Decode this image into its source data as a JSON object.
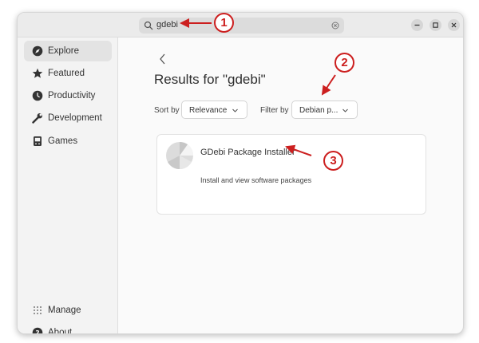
{
  "search": {
    "query": "gdebi"
  },
  "sidebar": {
    "items": [
      {
        "label": "Explore",
        "icon": "compass-icon",
        "active": true
      },
      {
        "label": "Featured",
        "icon": "star-icon"
      },
      {
        "label": "Productivity",
        "icon": "clock-icon"
      },
      {
        "label": "Development",
        "icon": "wrench-icon"
      },
      {
        "label": "Games",
        "icon": "gamepad-icon"
      }
    ],
    "bottom": [
      {
        "label": "Manage",
        "icon": "grid-dots-icon"
      },
      {
        "label": "About",
        "icon": "help-icon"
      }
    ]
  },
  "main": {
    "title": "Results for \"gdebi\"",
    "sort_label": "Sort by",
    "sort_value": "Relevance",
    "filter_label": "Filter by",
    "filter_value": "Debian p..."
  },
  "result": {
    "name": "GDebi Package Installer",
    "description": "Install and view software packages"
  },
  "annotations": [
    "1",
    "2",
    "3"
  ],
  "colors": {
    "annotation": "#cc1f1f",
    "sidebar_active": "#e3e3e3"
  }
}
